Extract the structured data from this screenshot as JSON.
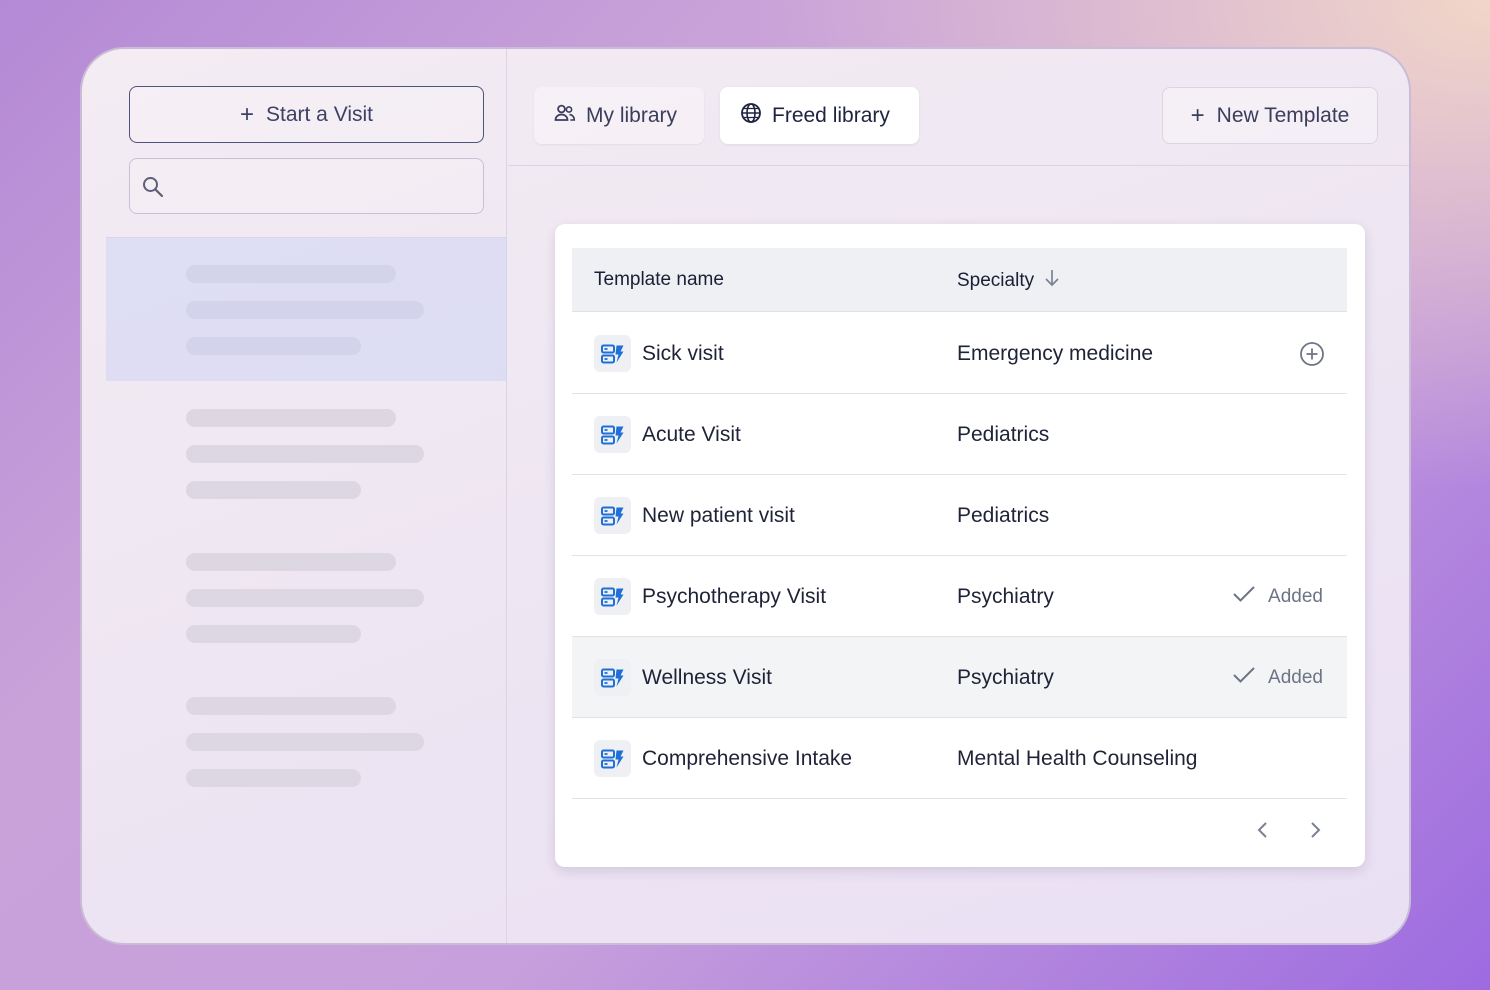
{
  "sidebar": {
    "start_visit_label": "Start a Visit",
    "search": {
      "placeholder": "",
      "value": ""
    }
  },
  "tabs": [
    {
      "label": "My library",
      "icon": "people-icon",
      "active": false
    },
    {
      "label": "Freed library",
      "icon": "globe-icon",
      "active": true
    }
  ],
  "new_template_label": "New Template",
  "table": {
    "columns": {
      "name": "Template name",
      "specialty": "Specialty"
    },
    "rows": [
      {
        "name": "Sick visit",
        "specialty": "Emergency medicine",
        "action": "add"
      },
      {
        "name": "Acute Visit",
        "specialty": "Pediatrics",
        "action": ""
      },
      {
        "name": "New patient visit",
        "specialty": "Pediatrics",
        "action": ""
      },
      {
        "name": "Psychotherapy Visit",
        "specialty": "Psychiatry",
        "action": "added",
        "status": "Added"
      },
      {
        "name": "Wellness Visit",
        "specialty": "Psychiatry",
        "action": "added",
        "status": "Added"
      },
      {
        "name": "Comprehensive Intake",
        "specialty": "Mental Health Counseling",
        "action": ""
      }
    ]
  },
  "colors": {
    "accent": "#1f6fd6",
    "text": "#1f2337",
    "muted": "#6c7487"
  }
}
